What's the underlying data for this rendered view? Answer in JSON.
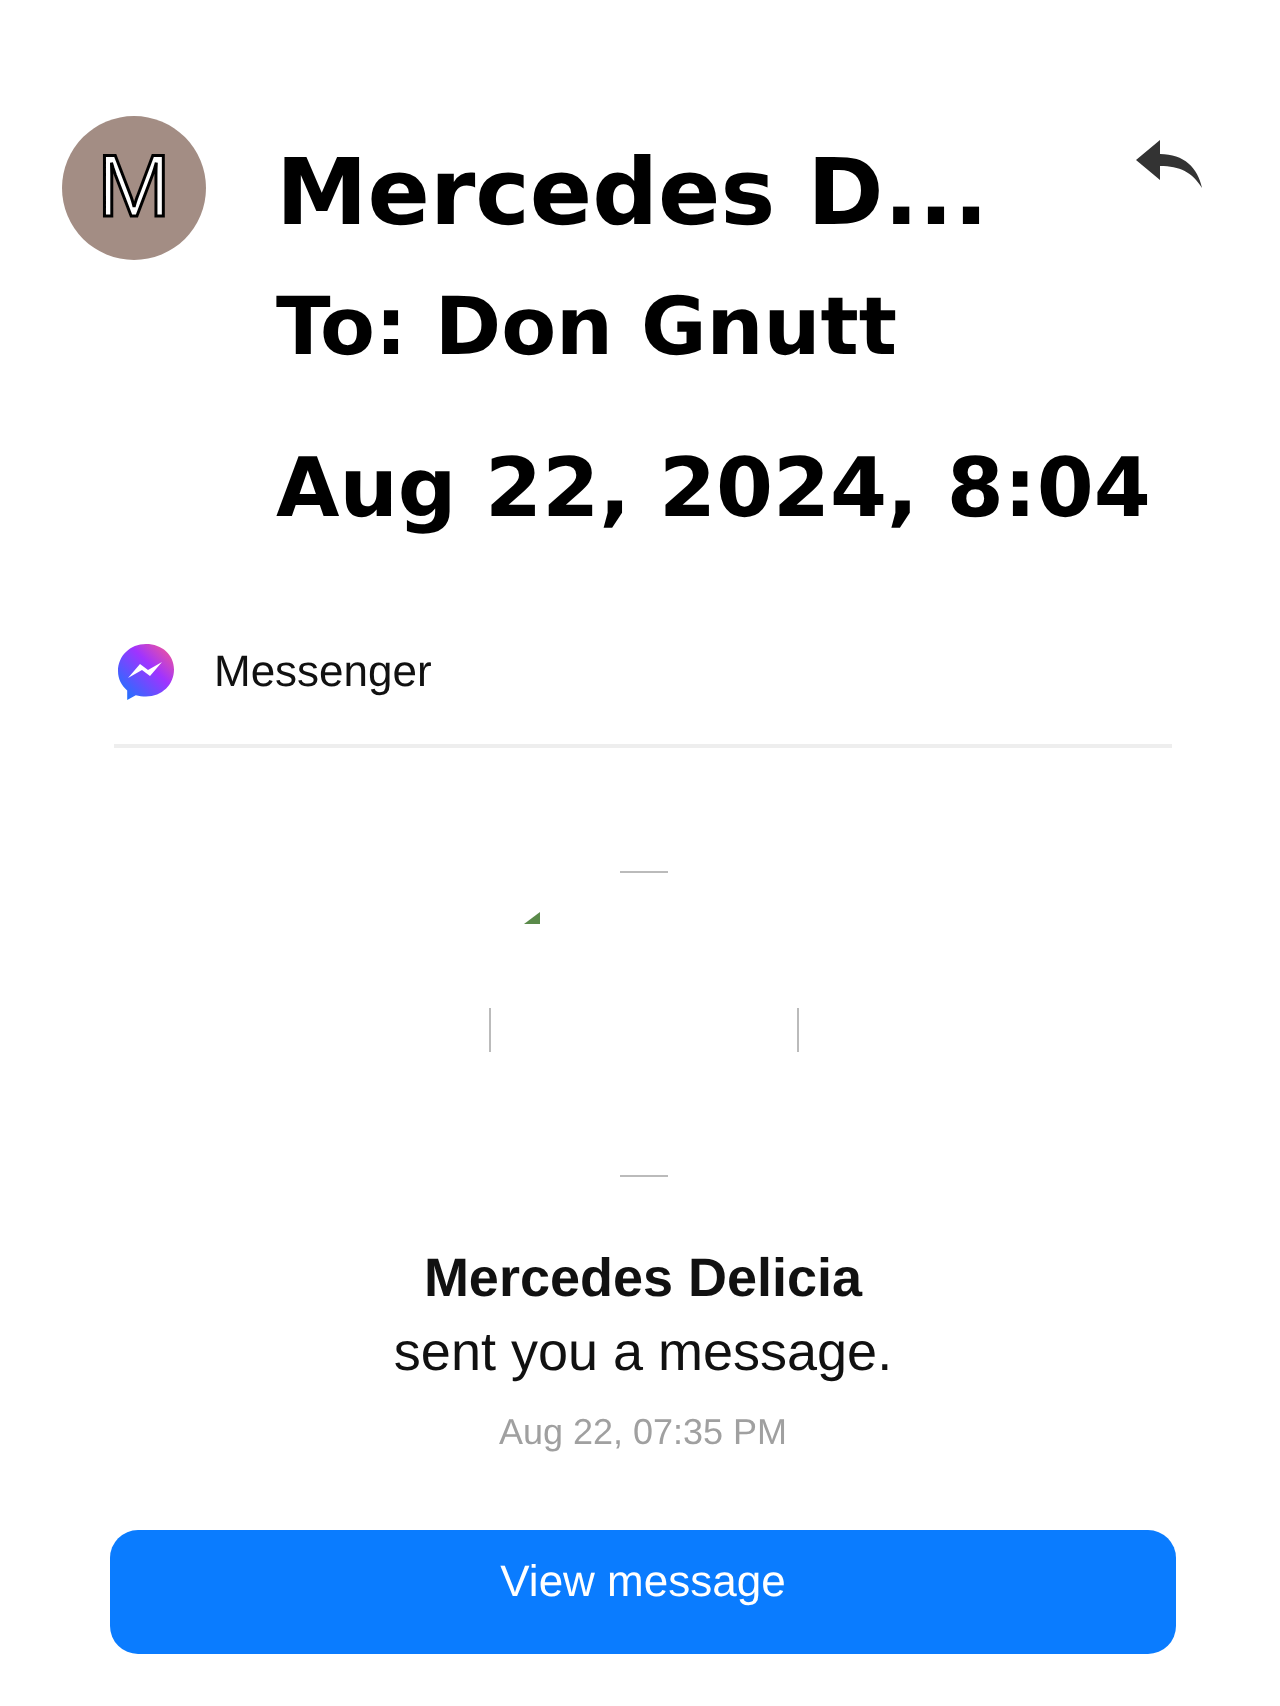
{
  "sender": {
    "avatar_letter": "M",
    "name": "Mercedes D...",
    "to": "To: Don Gnutt",
    "date": "Aug 22, 2024, 8:04"
  },
  "email": {
    "brand": "Messenger",
    "name": "Mercedes Delicia",
    "text": "sent you a message.",
    "time": "Aug 22, 07:35 PM",
    "button": "View message"
  }
}
